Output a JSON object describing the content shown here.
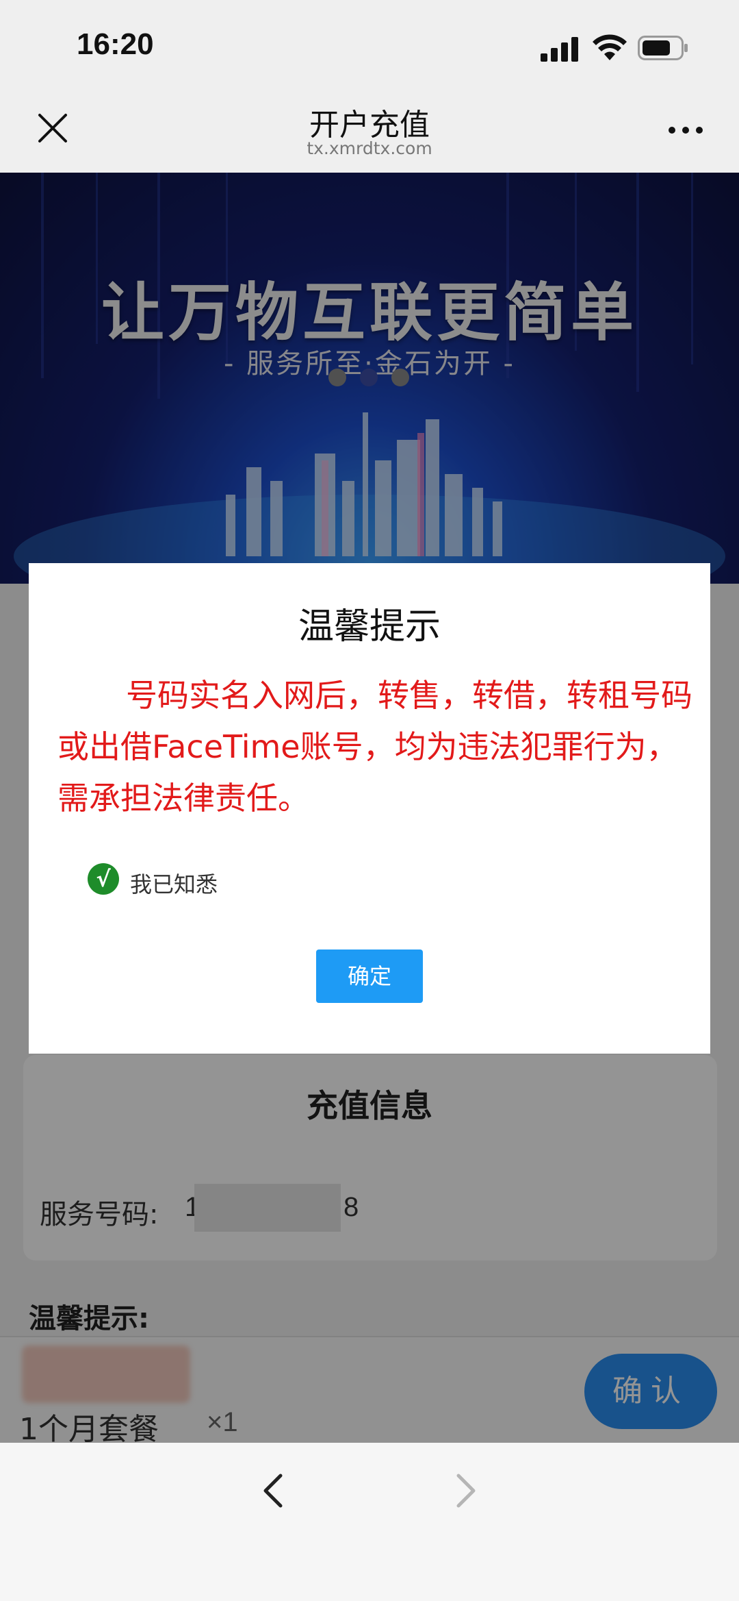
{
  "status": {
    "time": "16:20"
  },
  "nav": {
    "title": "开户充值",
    "subtitle": "tx.xmrdtx.com"
  },
  "banner": {
    "title": "让万物互联更简单",
    "subtitle": "- 服务所至·金石为开 -"
  },
  "page": {
    "card_title": "充值信息",
    "service_label": "服务号码:",
    "service_prefix": "1",
    "service_suffix": "8",
    "tips_heading": "温馨提示:",
    "package_name": "1个月套餐",
    "quantity": "×1",
    "confirm_label": "确认"
  },
  "modal": {
    "title": "温馨提示",
    "message": "号码实名入网后，转售，转借，转租号码或出借FaceTime账号，均为违法犯罪行为，需承担法律责任。",
    "ack_label": "我已知悉",
    "ack_checked": true,
    "ok_label": "确定"
  },
  "colors": {
    "accent_blue": "#2a8ef0",
    "warning_red": "#e21a1a",
    "check_green": "#1e8c2a"
  }
}
